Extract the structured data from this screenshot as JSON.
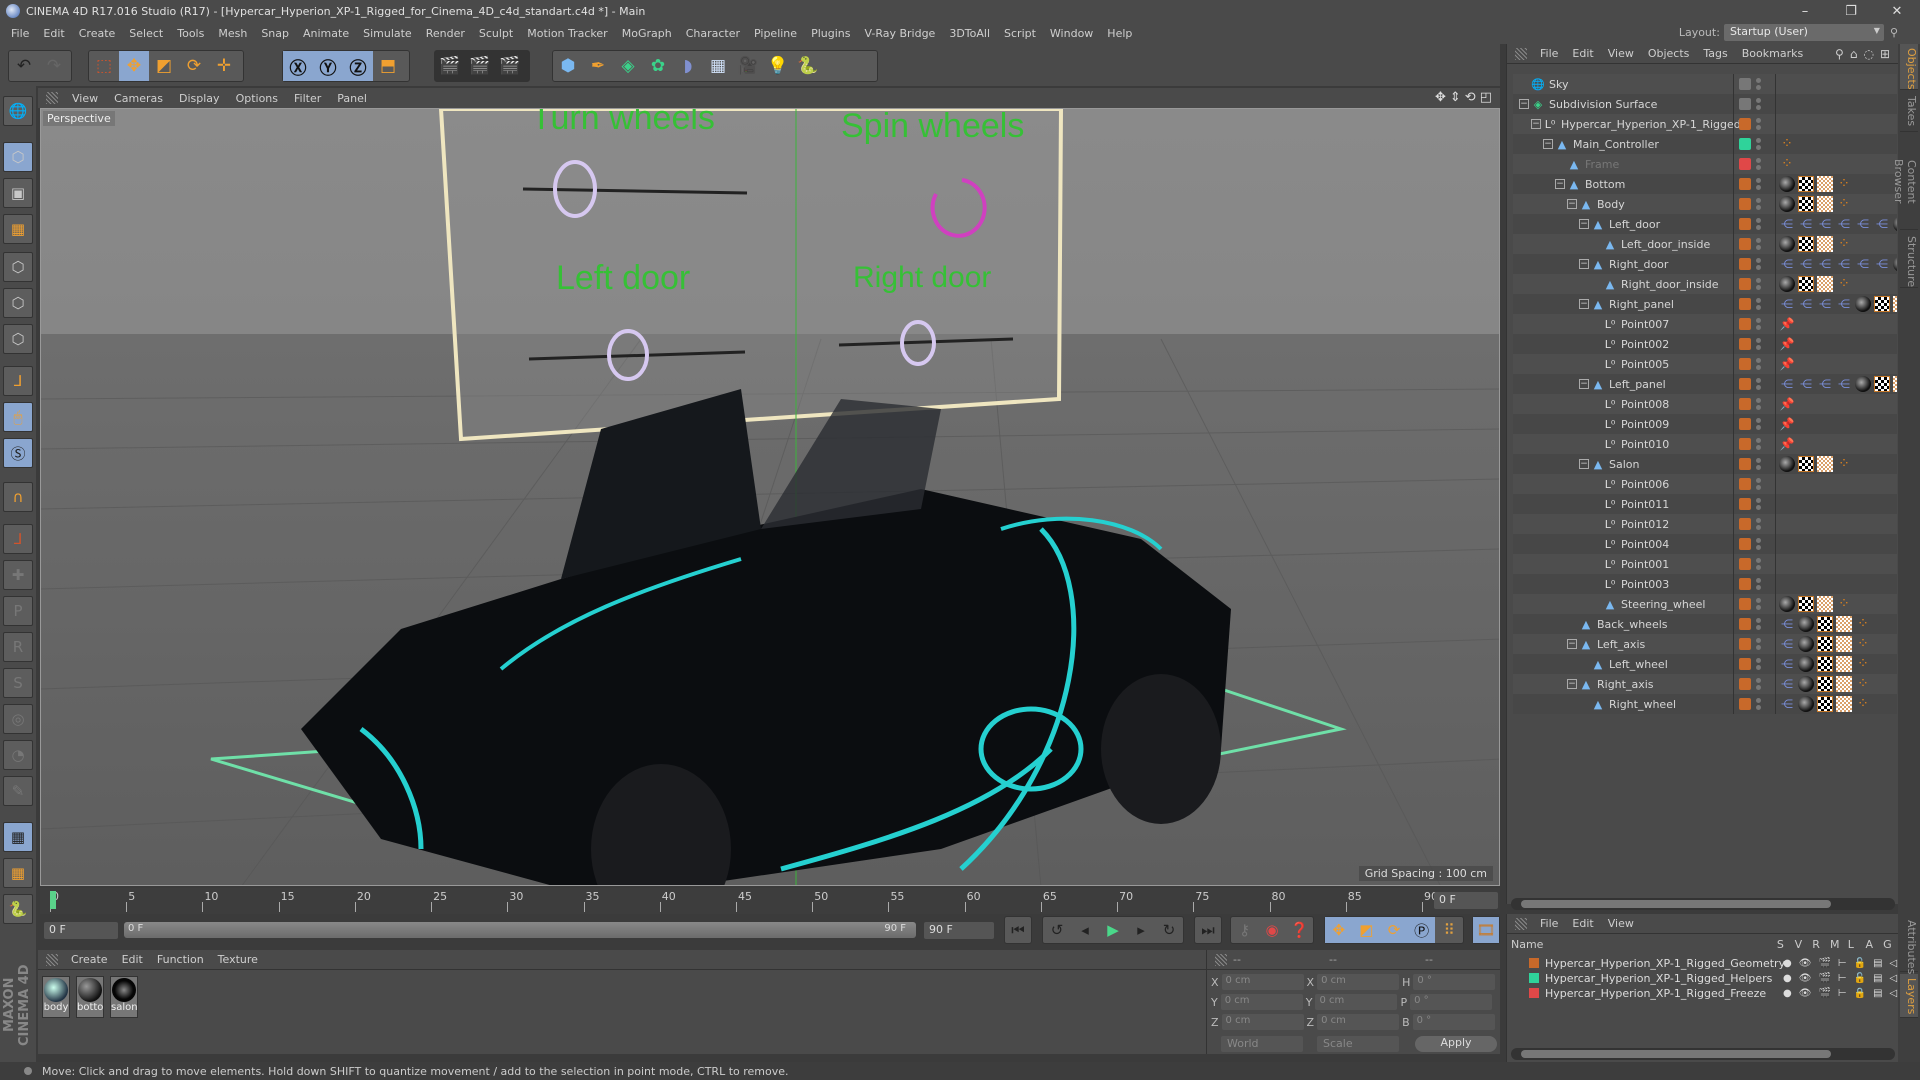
{
  "app": {
    "title": "CINEMA 4D R17.016 Studio (R17) - [Hypercar_Hyperion_XP-1_Rigged_for_Cinema_4D_c4d_standart.c4d *] - Main",
    "window_controls": {
      "minimize": "–",
      "maximize": "❐",
      "close": "✕"
    }
  },
  "menubar": [
    "File",
    "Edit",
    "Create",
    "Select",
    "Tools",
    "Mesh",
    "Snap",
    "Animate",
    "Simulate",
    "Render",
    "Sculpt",
    "Motion Tracker",
    "MoGraph",
    "Character",
    "Pipeline",
    "Plugins",
    "V-Ray Bridge",
    "3DToAll",
    "Script",
    "Window",
    "Help"
  ],
  "layout": {
    "label": "Layout:",
    "value": "Startup (User)"
  },
  "toolbar": {
    "undo": "undo-icon",
    "redo": "redo-icon",
    "tools": [
      "live-selection",
      "move",
      "scale",
      "rotate",
      "recent-tool"
    ],
    "axes": [
      "X",
      "Y",
      "Z"
    ],
    "coord_system": "world-coordinate-system",
    "render": [
      "render-view",
      "render-to-picture-viewer",
      "edit-render-settings"
    ],
    "create": [
      "cube",
      "pen-spline",
      "subdivision-surface",
      "cloner",
      "deformer",
      "floor",
      "camera",
      "light",
      "python"
    ]
  },
  "viewport": {
    "menu": [
      "View",
      "Cameras",
      "Display",
      "Options",
      "Filter",
      "Panel"
    ],
    "camera_label": "Perspective",
    "grid_spacing": "Grid Spacing : 100 cm",
    "controller_labels": [
      "Turn wheels",
      "Spin wheels",
      "Left door",
      "Right door"
    ]
  },
  "timeline": {
    "ticks": [
      "0",
      "5",
      "10",
      "15",
      "20",
      "25",
      "30",
      "35",
      "40",
      "45",
      "50",
      "55",
      "60",
      "65",
      "70",
      "75",
      "80",
      "85",
      "90"
    ],
    "current_frame": "0 F",
    "start_frame": "0 F",
    "range_start": "0 F",
    "range_end": "90 F",
    "end_frame": "90 F"
  },
  "material_manager": {
    "menu": [
      "Create",
      "Edit",
      "Function",
      "Texture"
    ],
    "materials": [
      {
        "name": "body"
      },
      {
        "name": "botto"
      },
      {
        "name": "salon"
      }
    ]
  },
  "coordinates": {
    "headers": [
      "--",
      "--",
      "--"
    ],
    "position": {
      "X": "0 cm",
      "Y": "0 cm",
      "Z": "0 cm"
    },
    "size": {
      "X": "0 cm",
      "Y": "0 cm",
      "Z": "0 cm"
    },
    "rotation": {
      "H": "0 °",
      "P": "0 °",
      "B": "0 °"
    },
    "space": "World",
    "mode": "Scale",
    "apply": "Apply"
  },
  "status": "Move: Click and drag to move elements. Hold down SHIFT to quantize movement / add to the selection in point mode, CTRL to remove.",
  "object_manager": {
    "menu": [
      "File",
      "Edit",
      "View",
      "Objects",
      "Tags",
      "Bookmarks"
    ],
    "objects": [
      {
        "name": "Sky",
        "depth": 0,
        "type": "sky",
        "layer": "#777777",
        "tags": []
      },
      {
        "name": "Subdivision Surface",
        "depth": 0,
        "type": "sds",
        "layer": "#777777",
        "tags": []
      },
      {
        "name": "Hypercar_Hyperion_XP-1_Rigged",
        "depth": 1,
        "type": "null",
        "layer": "#c8692a",
        "tags": []
      },
      {
        "name": "Main_Controller",
        "depth": 2,
        "type": "joint",
        "layer": "#2fd39a",
        "tags": [
          "xpresso"
        ]
      },
      {
        "name": "Frame",
        "depth": 3,
        "type": "joint",
        "layer": "#e04848",
        "tags": [
          "xpresso"
        ]
      },
      {
        "name": "Bottom",
        "depth": 3,
        "type": "joint",
        "layer": "#c8692a",
        "tags": [
          "material",
          "checker",
          "uvw",
          "xpresso"
        ]
      },
      {
        "name": "Body",
        "depth": 4,
        "type": "joint",
        "layer": "#c8692a",
        "tags": [
          "material",
          "checker",
          "uvw",
          "xpresso"
        ]
      },
      {
        "name": "Left_door",
        "depth": 5,
        "type": "joint",
        "layer": "#c8692a",
        "tags": [
          "ik",
          "ik",
          "ik",
          "ik",
          "ik",
          "ik",
          "material"
        ]
      },
      {
        "name": "Left_door_inside",
        "depth": 6,
        "type": "joint",
        "layer": "#c8692a",
        "tags": [
          "material",
          "checker",
          "uvw",
          "xpresso"
        ]
      },
      {
        "name": "Right_door",
        "depth": 5,
        "type": "joint",
        "layer": "#c8692a",
        "tags": [
          "ik",
          "ik",
          "ik",
          "ik",
          "ik",
          "ik",
          "material"
        ]
      },
      {
        "name": "Right_door_inside",
        "depth": 6,
        "type": "joint",
        "layer": "#c8692a",
        "tags": [
          "material",
          "checker",
          "uvw",
          "xpresso"
        ]
      },
      {
        "name": "Right_panel",
        "depth": 5,
        "type": "joint",
        "layer": "#c8692a",
        "tags": [
          "ik",
          "ik",
          "ik",
          "ik",
          "material",
          "checker",
          "uvw"
        ]
      },
      {
        "name": "Point007",
        "depth": 6,
        "type": "null",
        "layer": "#c8692a",
        "tags": [
          "pin"
        ]
      },
      {
        "name": "Point002",
        "depth": 6,
        "type": "null",
        "layer": "#c8692a",
        "tags": [
          "pin"
        ]
      },
      {
        "name": "Point005",
        "depth": 6,
        "type": "null",
        "layer": "#c8692a",
        "tags": [
          "pin"
        ]
      },
      {
        "name": "Left_panel",
        "depth": 5,
        "type": "joint",
        "layer": "#c8692a",
        "tags": [
          "ik",
          "ik",
          "ik",
          "ik",
          "material",
          "checker",
          "uvw"
        ]
      },
      {
        "name": "Point008",
        "depth": 6,
        "type": "null",
        "layer": "#c8692a",
        "tags": [
          "pin"
        ]
      },
      {
        "name": "Point009",
        "depth": 6,
        "type": "null",
        "layer": "#c8692a",
        "tags": [
          "pin"
        ]
      },
      {
        "name": "Point010",
        "depth": 6,
        "type": "null",
        "layer": "#c8692a",
        "tags": [
          "pin"
        ]
      },
      {
        "name": "Salon",
        "depth": 5,
        "type": "joint",
        "layer": "#c8692a",
        "tags": [
          "material",
          "checker",
          "uvw",
          "xpresso"
        ]
      },
      {
        "name": "Point006",
        "depth": 6,
        "type": "null",
        "layer": "#c8692a",
        "tags": []
      },
      {
        "name": "Point011",
        "depth": 6,
        "type": "null",
        "layer": "#c8692a",
        "tags": []
      },
      {
        "name": "Point012",
        "depth": 6,
        "type": "null",
        "layer": "#c8692a",
        "tags": []
      },
      {
        "name": "Point004",
        "depth": 6,
        "type": "null",
        "layer": "#c8692a",
        "tags": []
      },
      {
        "name": "Point001",
        "depth": 6,
        "type": "null",
        "layer": "#c8692a",
        "tags": []
      },
      {
        "name": "Point003",
        "depth": 6,
        "type": "null",
        "layer": "#c8692a",
        "tags": []
      },
      {
        "name": "Steering_wheel",
        "depth": 6,
        "type": "joint",
        "layer": "#c8692a",
        "tags": [
          "material",
          "checker",
          "uvw",
          "xpresso"
        ]
      },
      {
        "name": "Back_wheels",
        "depth": 4,
        "type": "joint",
        "layer": "#c8692a",
        "tags": [
          "ik",
          "material",
          "checker",
          "uvw",
          "xpresso"
        ]
      },
      {
        "name": "Left_axis",
        "depth": 4,
        "type": "joint",
        "layer": "#c8692a",
        "tags": [
          "ik",
          "material",
          "checker",
          "uvw",
          "xpresso"
        ]
      },
      {
        "name": "Left_wheel",
        "depth": 5,
        "type": "joint",
        "layer": "#c8692a",
        "tags": [
          "ik",
          "material",
          "checker",
          "uvw",
          "xpresso"
        ]
      },
      {
        "name": "Right_axis",
        "depth": 4,
        "type": "joint",
        "layer": "#c8692a",
        "tags": [
          "ik",
          "material",
          "checker",
          "uvw",
          "xpresso"
        ]
      },
      {
        "name": "Right_wheel",
        "depth": 5,
        "type": "joint",
        "layer": "#c8692a",
        "tags": [
          "ik",
          "material",
          "checker",
          "uvw",
          "xpresso"
        ]
      }
    ]
  },
  "side_tabs": [
    "Objects",
    "Takes",
    "Content Browser",
    "Structure"
  ],
  "side_tabs_bottom": [
    "Attributes",
    "Layers"
  ],
  "layer_manager": {
    "menu": [
      "File",
      "Edit",
      "View"
    ],
    "columns": [
      "Name",
      "S",
      "V",
      "R",
      "M",
      "L",
      "A",
      "G"
    ],
    "layers": [
      {
        "name": "Hypercar_Hyperion_XP-1_Rigged_Geometry",
        "color": "#c8692a",
        "locked": false
      },
      {
        "name": "Hypercar_Hyperion_XP-1_Rigged_Helpers",
        "color": "#2fd39a",
        "locked": false
      },
      {
        "name": "Hypercar_Hyperion_XP-1_Rigged_Freeze",
        "color": "#e04848",
        "locked": true
      }
    ]
  },
  "branding": "MAXON CINEMA 4D"
}
